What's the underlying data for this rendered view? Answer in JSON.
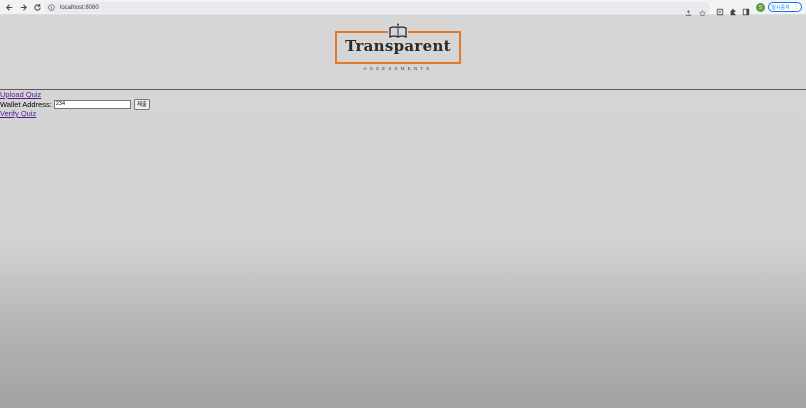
{
  "browser": {
    "url": "localhost:8080",
    "profile_initial": "S",
    "pause_label": "일시중지"
  },
  "logo": {
    "title": "Transparent",
    "subtitle": "ASSESSMENTS",
    "accent_color": "#e27a2c"
  },
  "page": {
    "upload_link": "Upload Quiz",
    "wallet_label": "Wallet Address:",
    "wallet_value": "234",
    "submit_label": "제출",
    "verify_link": "Verify Quiz",
    "link_color": "#551a8b"
  }
}
